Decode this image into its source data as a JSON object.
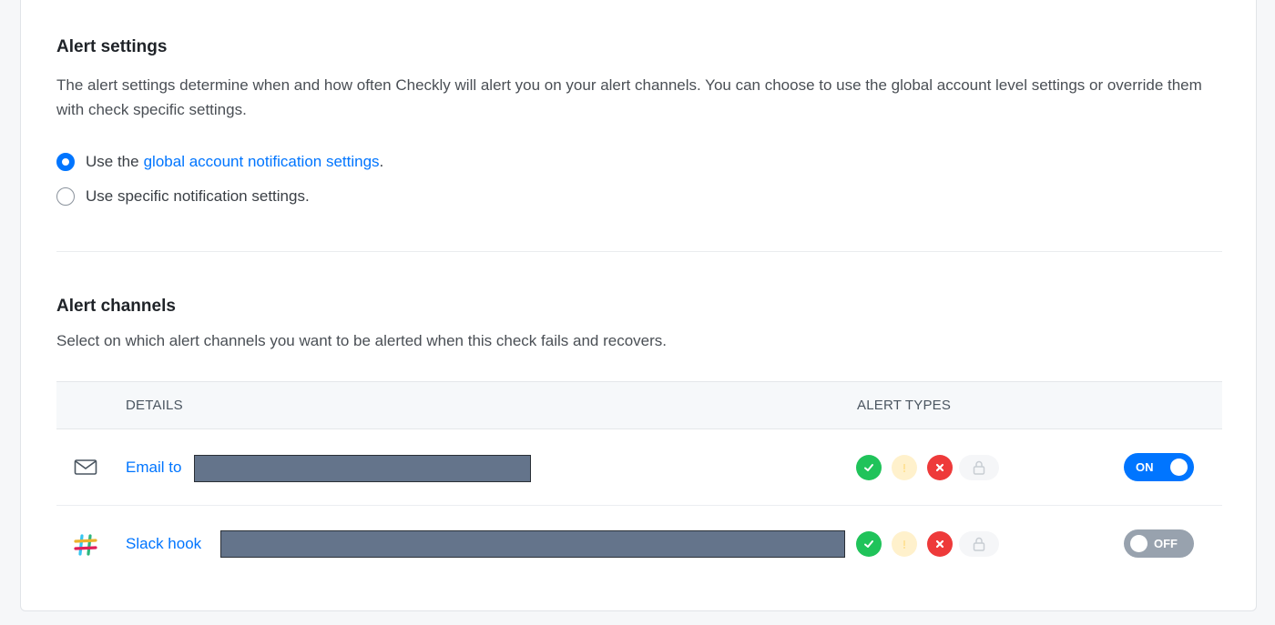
{
  "alert_settings": {
    "title": "Alert settings",
    "description": "The alert settings determine when and how often Checkly will alert you on your alert channels. You can choose to use the global account level settings or override them with check specific settings.",
    "options": [
      {
        "prefix": "Use the",
        "link": "global account notification settings",
        "suffix": ".",
        "selected": true
      },
      {
        "prefix": "Use specific notification settings.",
        "selected": false
      }
    ]
  },
  "alert_channels": {
    "title": "Alert channels",
    "description": "Select on which alert channels you want to be alerted when this check fails and recovers.",
    "columns": {
      "details": "DETAILS",
      "alert_types": "ALERT TYPES"
    },
    "rows": [
      {
        "icon": "mail-icon",
        "label": "Email to",
        "toggle": "ON",
        "enabled": true
      },
      {
        "icon": "slack-icon",
        "label": "Slack hook",
        "toggle": "OFF",
        "enabled": false
      }
    ]
  },
  "colors": {
    "accent": "#0075ff",
    "success": "#20c35a",
    "warning": "#fff1cc",
    "failure": "#ee3a3a",
    "toggle_off": "#98a2ae"
  }
}
